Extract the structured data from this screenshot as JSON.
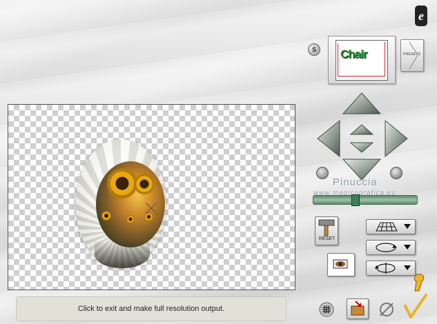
{
  "status": {
    "message": "Click to exit and make full resolution output."
  },
  "thumbnail": {
    "text": "Chair"
  },
  "buttons": {
    "presets_label": "PRESETS",
    "s_label": "S",
    "help_label": "e",
    "reset_label": "RESET"
  },
  "watermark": {
    "title": "Pinuccia",
    "url": "www.magicografica.eu"
  },
  "icons": {
    "nav": [
      "arrow-up-icon",
      "arrow-left-icon",
      "arrow-right-icon",
      "arrow-down-icon",
      "center-up-icon",
      "center-down-icon"
    ],
    "rotate": [
      "rotate-left-icon",
      "rotate-right-icon"
    ],
    "tools": [
      "hammer-icon",
      "grid-plane-icon",
      "ellipse-rotate-icon",
      "axis-rotate-icon",
      "eye-preview-icon",
      "grid-icon",
      "open-folder-icon",
      "cancel-icon",
      "ok-check-icon",
      "hand-icon"
    ]
  },
  "colors": {
    "status_bg": "#e1e1d8",
    "slider": "#3e7f57",
    "accent_check": "#e4b32a"
  }
}
